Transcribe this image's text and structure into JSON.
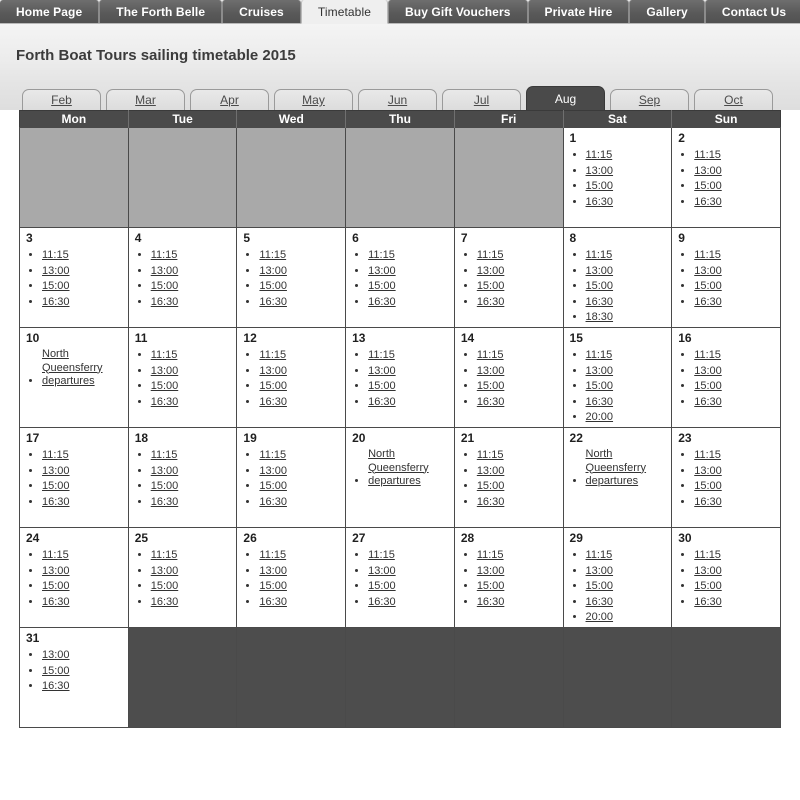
{
  "nav": {
    "items": [
      {
        "label": "Home Page",
        "active": false
      },
      {
        "label": "The Forth Belle",
        "active": false
      },
      {
        "label": "Cruises",
        "active": false
      },
      {
        "label": "Timetable",
        "active": true
      },
      {
        "label": "Buy Gift Vouchers",
        "active": false
      },
      {
        "label": "Private Hire",
        "active": false
      },
      {
        "label": "Gallery",
        "active": false
      },
      {
        "label": "Contact Us",
        "active": false
      }
    ]
  },
  "header": {
    "title": "Forth Boat Tours sailing timetable 2015"
  },
  "months": {
    "selected": "Aug",
    "tabs": [
      {
        "label": "Feb",
        "active": false
      },
      {
        "label": "Mar",
        "active": false
      },
      {
        "label": "Apr",
        "active": false
      },
      {
        "label": "May",
        "active": false
      },
      {
        "label": "Jun",
        "active": false
      },
      {
        "label": "Jul",
        "active": false
      },
      {
        "label": "Aug",
        "active": true
      },
      {
        "label": "Sep",
        "active": false
      },
      {
        "label": "Oct",
        "active": false
      }
    ]
  },
  "calendar": {
    "weekday_headers": [
      "Mon",
      "Tue",
      "Wed",
      "Thu",
      "Fri",
      "Sat",
      "Sun"
    ],
    "special_label": "North Queensferry departures",
    "weeks": [
      [
        {
          "type": "blank-before"
        },
        {
          "type": "blank-before"
        },
        {
          "type": "blank-before"
        },
        {
          "type": "blank-before"
        },
        {
          "type": "blank-before"
        },
        {
          "type": "day",
          "day": "1",
          "times": [
            "11:15",
            "13:00",
            "15:00",
            "16:30"
          ]
        },
        {
          "type": "day",
          "day": "2",
          "times": [
            "11:15",
            "13:00",
            "15:00",
            "16:30"
          ]
        }
      ],
      [
        {
          "type": "day",
          "day": "3",
          "times": [
            "11:15",
            "13:00",
            "15:00",
            "16:30"
          ]
        },
        {
          "type": "day",
          "day": "4",
          "times": [
            "11:15",
            "13:00",
            "15:00",
            "16:30"
          ]
        },
        {
          "type": "day",
          "day": "5",
          "times": [
            "11:15",
            "13:00",
            "15:00",
            "16:30"
          ]
        },
        {
          "type": "day",
          "day": "6",
          "times": [
            "11:15",
            "13:00",
            "15:00",
            "16:30"
          ]
        },
        {
          "type": "day",
          "day": "7",
          "times": [
            "11:15",
            "13:00",
            "15:00",
            "16:30"
          ]
        },
        {
          "type": "day",
          "day": "8",
          "times": [
            "11:15",
            "13:00",
            "15:00",
            "16:30",
            "18:30"
          ]
        },
        {
          "type": "day",
          "day": "9",
          "times": [
            "11:15",
            "13:00",
            "15:00",
            "16:30"
          ]
        }
      ],
      [
        {
          "type": "day",
          "day": "10",
          "special": "North Queensferry departures",
          "times": []
        },
        {
          "type": "day",
          "day": "11",
          "times": [
            "11:15",
            "13:00",
            "15:00",
            "16:30"
          ]
        },
        {
          "type": "day",
          "day": "12",
          "times": [
            "11:15",
            "13:00",
            "15:00",
            "16:30"
          ]
        },
        {
          "type": "day",
          "day": "13",
          "times": [
            "11:15",
            "13:00",
            "15:00",
            "16:30"
          ]
        },
        {
          "type": "day",
          "day": "14",
          "times": [
            "11:15",
            "13:00",
            "15:00",
            "16:30"
          ]
        },
        {
          "type": "day",
          "day": "15",
          "times": [
            "11:15",
            "13:00",
            "15:00",
            "16:30",
            "20:00"
          ]
        },
        {
          "type": "day",
          "day": "16",
          "times": [
            "11:15",
            "13:00",
            "15:00",
            "16:30"
          ]
        }
      ],
      [
        {
          "type": "day",
          "day": "17",
          "times": [
            "11:15",
            "13:00",
            "15:00",
            "16:30"
          ]
        },
        {
          "type": "day",
          "day": "18",
          "times": [
            "11:15",
            "13:00",
            "15:00",
            "16:30"
          ]
        },
        {
          "type": "day",
          "day": "19",
          "times": [
            "11:15",
            "13:00",
            "15:00",
            "16:30"
          ]
        },
        {
          "type": "day",
          "day": "20",
          "special": "North Queensferry departures",
          "times": []
        },
        {
          "type": "day",
          "day": "21",
          "times": [
            "11:15",
            "13:00",
            "15:00",
            "16:30"
          ]
        },
        {
          "type": "day",
          "day": "22",
          "special": "North Queensferry departures",
          "times": []
        },
        {
          "type": "day",
          "day": "23",
          "times": [
            "11:15",
            "13:00",
            "15:00",
            "16:30"
          ]
        }
      ],
      [
        {
          "type": "day",
          "day": "24",
          "times": [
            "11:15",
            "13:00",
            "15:00",
            "16:30"
          ]
        },
        {
          "type": "day",
          "day": "25",
          "times": [
            "11:15",
            "13:00",
            "15:00",
            "16:30"
          ]
        },
        {
          "type": "day",
          "day": "26",
          "times": [
            "11:15",
            "13:00",
            "15:00",
            "16:30"
          ]
        },
        {
          "type": "day",
          "day": "27",
          "times": [
            "11:15",
            "13:00",
            "15:00",
            "16:30"
          ]
        },
        {
          "type": "day",
          "day": "28",
          "times": [
            "11:15",
            "13:00",
            "15:00",
            "16:30"
          ]
        },
        {
          "type": "day",
          "day": "29",
          "times": [
            "11:15",
            "13:00",
            "15:00",
            "16:30",
            "20:00"
          ]
        },
        {
          "type": "day",
          "day": "30",
          "times": [
            "11:15",
            "13:00",
            "15:00",
            "16:30"
          ]
        }
      ],
      [
        {
          "type": "day",
          "day": "31",
          "times": [
            "13:00",
            "15:00",
            "16:30"
          ]
        },
        {
          "type": "blank-after"
        },
        {
          "type": "blank-after"
        },
        {
          "type": "blank-after"
        },
        {
          "type": "blank-after"
        },
        {
          "type": "blank-after"
        },
        {
          "type": "blank-after"
        }
      ]
    ]
  },
  "colors": {
    "nav_tab_bg": "#5a5a5a",
    "nav_tab_active_bg": "#efefef",
    "header_bar_bg": "#4a4a4a",
    "blank_before_bg": "#a9a9a9",
    "blank_after_bg": "#4d4d4d",
    "link": "#333333"
  }
}
